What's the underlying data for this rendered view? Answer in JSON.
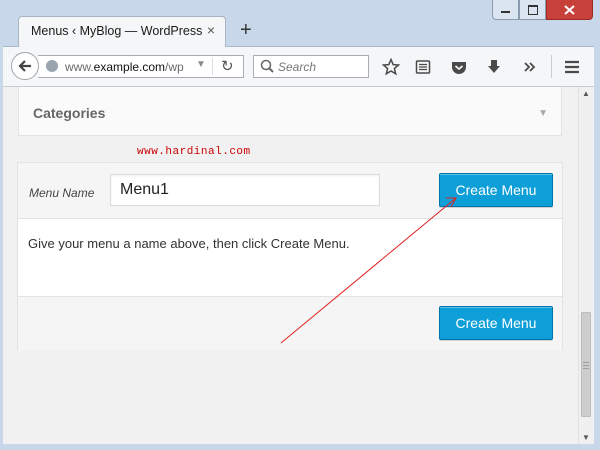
{
  "browser": {
    "tab_title": "Menus ‹ MyBlog — WordPress",
    "tab_close_glyph": "×",
    "new_tab_glyph": "+",
    "url_prefix": "www.",
    "url_domain": "example.com",
    "url_suffix": "/wp",
    "search_placeholder": "Search",
    "icons": [
      "back-arrow-icon",
      "globe-icon",
      "reload-icon",
      "search-icon",
      "bookmark-star-icon",
      "reading-list-icon",
      "pocket-icon",
      "download-icon",
      "overflow-chevrons-icon",
      "hamburger-menu-icon"
    ]
  },
  "window": {
    "controls": [
      "minimize",
      "maximize",
      "close"
    ],
    "close_color": "#c7413a"
  },
  "categories": {
    "title": "Categories",
    "arrow_glyph": "▼"
  },
  "watermark": "www.hardinal.com",
  "menu_editor": {
    "name_label": "Menu Name",
    "name_value": "Menu1",
    "create_button_top": "Create Menu",
    "instructions": "Give your menu a name above, then click Create Menu.",
    "create_button_bottom": "Create Menu",
    "button_color": "#0f9fd8"
  },
  "annotation": {
    "arrow_color": "#e02020"
  }
}
